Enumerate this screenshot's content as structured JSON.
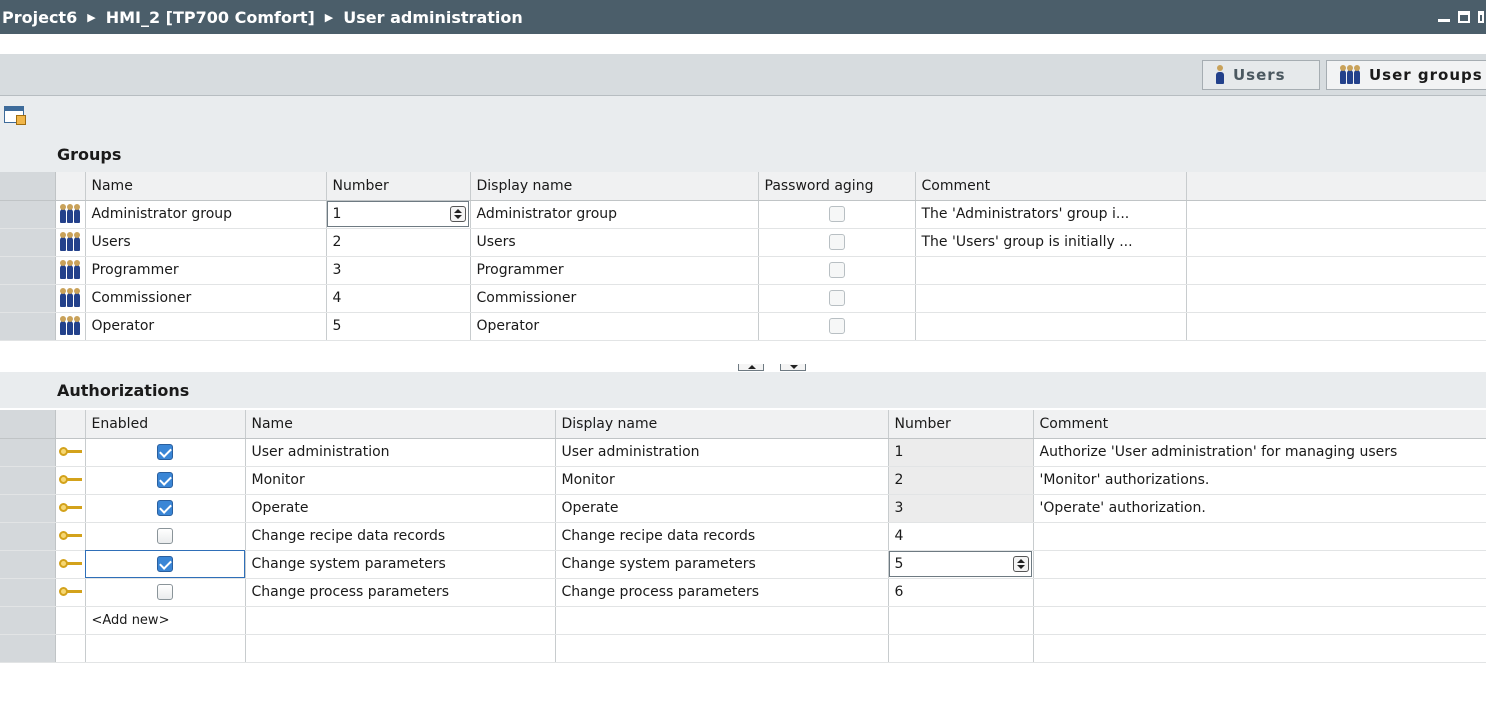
{
  "titlebar": {
    "crumb1": "Project6",
    "crumb2": "HMI_2 [TP700 Comfort]",
    "crumb3": "User administration"
  },
  "tabs": {
    "users": "Users",
    "user_groups": "User groups"
  },
  "groups": {
    "title": "Groups",
    "headers": [
      "Name",
      "Number",
      "Display name",
      "Password aging",
      "Comment"
    ],
    "rows": [
      {
        "name": "Administrator group",
        "number": "1",
        "display": "Administrator group",
        "comment": "The 'Administrators' group i..."
      },
      {
        "name": "Users",
        "number": "2",
        "display": "Users",
        "comment": "The 'Users' group is initially ..."
      },
      {
        "name": "Programmer",
        "number": "3",
        "display": "Programmer",
        "comment": ""
      },
      {
        "name": "Commissioner",
        "number": "4",
        "display": "Commissioner",
        "comment": ""
      },
      {
        "name": "Operator",
        "number": "5",
        "display": "Operator",
        "comment": ""
      }
    ]
  },
  "authorizations": {
    "title": "Authorizations",
    "headers": [
      "Enabled",
      "Name",
      "Display name",
      "Number",
      "Comment"
    ],
    "rows": [
      {
        "enabled": true,
        "name": "User administration",
        "display": "User administration",
        "number": "1",
        "comment": "Authorize 'User administration' for managing users"
      },
      {
        "enabled": true,
        "name": "Monitor",
        "display": "Monitor",
        "number": "2",
        "comment": "'Monitor' authorizations."
      },
      {
        "enabled": true,
        "name": "Operate",
        "display": "Operate",
        "number": "3",
        "comment": "'Operate' authorization."
      },
      {
        "enabled": false,
        "name": "Change recipe data records",
        "display": "Change recipe data records",
        "number": "4",
        "comment": ""
      },
      {
        "enabled": true,
        "name": "Change system parameters",
        "display": "Change system parameters",
        "number": "5",
        "comment": ""
      },
      {
        "enabled": false,
        "name": "Change process parameters",
        "display": "Change process parameters",
        "number": "6",
        "comment": ""
      }
    ],
    "add_new": "<Add new>"
  }
}
